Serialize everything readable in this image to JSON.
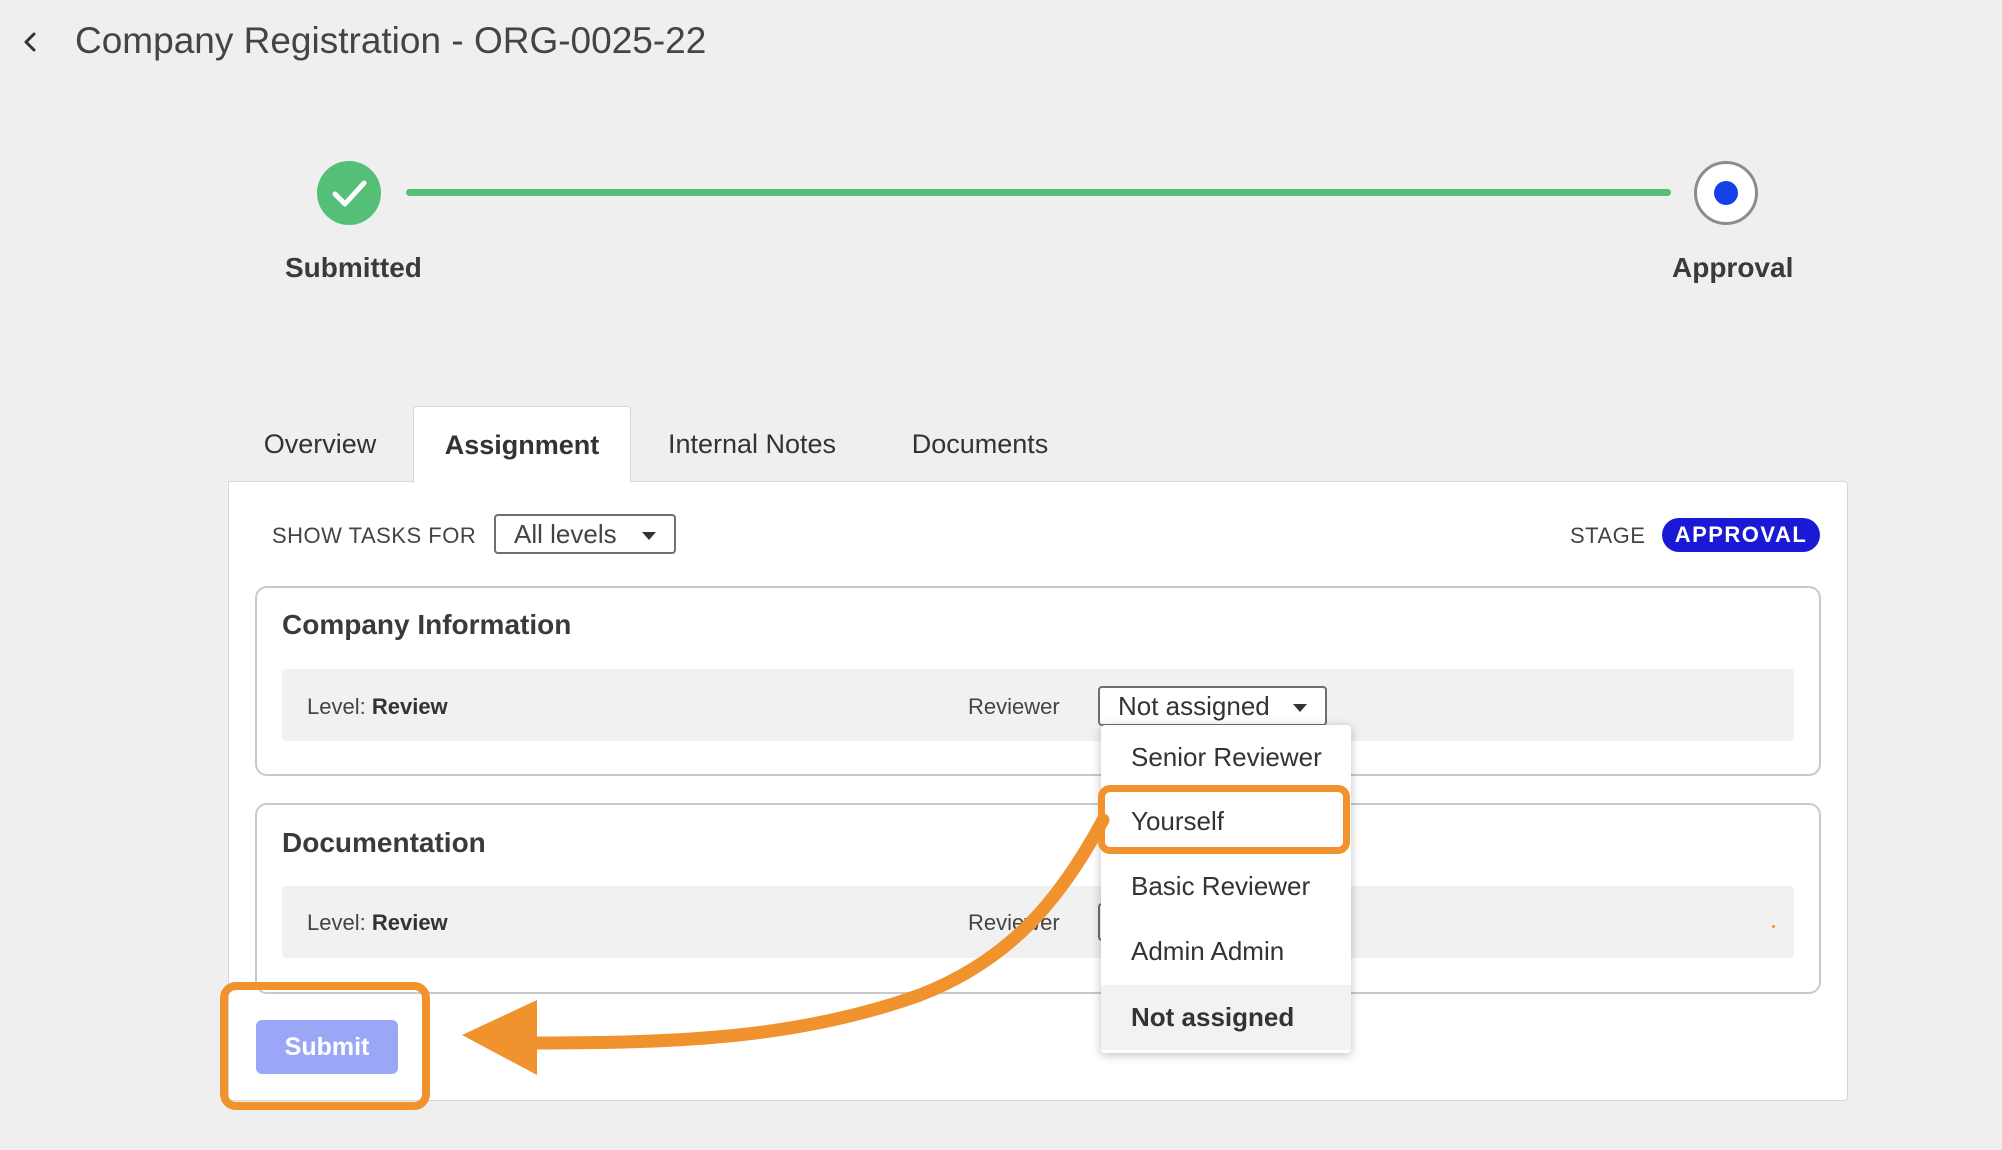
{
  "header": {
    "back_icon": "chevron-left-icon",
    "title": "Company Registration - ORG-0025-22"
  },
  "stepper": {
    "steps": [
      {
        "label": "Submitted",
        "status": "complete",
        "icon": "checkmark-icon"
      },
      {
        "label": "Approval",
        "status": "current"
      }
    ]
  },
  "tabs": [
    {
      "label": "Overview"
    },
    {
      "label": "Assignment",
      "active": true
    },
    {
      "label": "Internal Notes"
    },
    {
      "label": "Documents"
    }
  ],
  "filters": {
    "show_tasks_label": "SHOW TASKS FOR",
    "levels_value": "All levels",
    "stage_label": "STAGE",
    "stage_value": "APPROVAL"
  },
  "sections": [
    {
      "title": "Company Information",
      "level_prefix": "Level:",
      "level_value": "Review",
      "reviewer_label": "Reviewer",
      "reviewer_value": "Not assigned"
    },
    {
      "title": "Documentation",
      "level_prefix": "Level:",
      "level_value": "Review",
      "reviewer_label": "Reviewer"
    }
  ],
  "reviewer_menu": {
    "options": [
      "Senior Reviewer",
      "Yourself",
      "Basic Reviewer",
      "Admin Admin",
      "Not assigned"
    ],
    "selected": "Not assigned",
    "highlighted": "Yourself"
  },
  "actions": {
    "submit_label": "Submit"
  },
  "colors": {
    "complete_green": "#55bf78",
    "current_blue": "#1541e8",
    "stage_badge": "#1a1ad6",
    "submit_disabled": "#9aa7f7",
    "annotation_orange": "#f0932e"
  }
}
